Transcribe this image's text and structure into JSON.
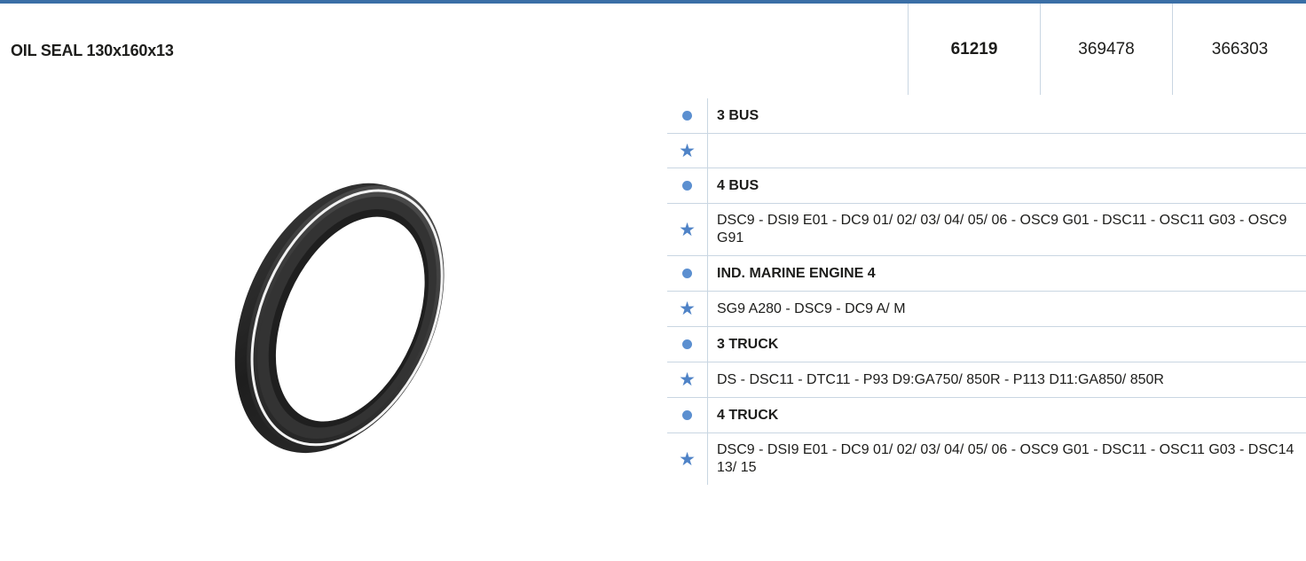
{
  "product": {
    "title": "OIL SEAL 130x160x13",
    "codes": {
      "primary": "61219",
      "second": "369478",
      "third": "366303"
    }
  },
  "applications": [
    {
      "type": "category",
      "icon": "dot-icon",
      "text": "3 BUS"
    },
    {
      "type": "models",
      "icon": "star-icon",
      "text": ""
    },
    {
      "type": "category",
      "icon": "dot-icon",
      "text": "4 BUS"
    },
    {
      "type": "models",
      "icon": "star-icon",
      "text": "DSC9 - DSI9 E01 - DC9 01/ 02/ 03/ 04/ 05/ 06 - OSC9 G01 - DSC11 - OSC11 G03 - OSC9 G91"
    },
    {
      "type": "category",
      "icon": "dot-icon",
      "text": "IND. MARINE ENGINE 4"
    },
    {
      "type": "models",
      "icon": "star-icon",
      "text": "SG9 A280 - DSC9 - DC9 A/ M"
    },
    {
      "type": "category",
      "icon": "dot-icon",
      "text": "3 TRUCK"
    },
    {
      "type": "models",
      "icon": "star-icon",
      "text": "DS - DSC11 - DTC11 - P93 D9:GA750/ 850R - P113 D11:GA850/ 850R"
    },
    {
      "type": "category",
      "icon": "dot-icon",
      "text": "4 TRUCK"
    },
    {
      "type": "models",
      "icon": "star-icon",
      "text": "DSC9 - DSI9 E01 - DC9 01/ 02/ 03/ 04/ 05/ 06 - OSC9 G01 - DSC11 - OSC11 G03 - DSC14 13/ 15"
    }
  ],
  "colors": {
    "accent": "#3b6fa6",
    "marker": "#5b8fd0",
    "divider": "#c9d6e2"
  }
}
